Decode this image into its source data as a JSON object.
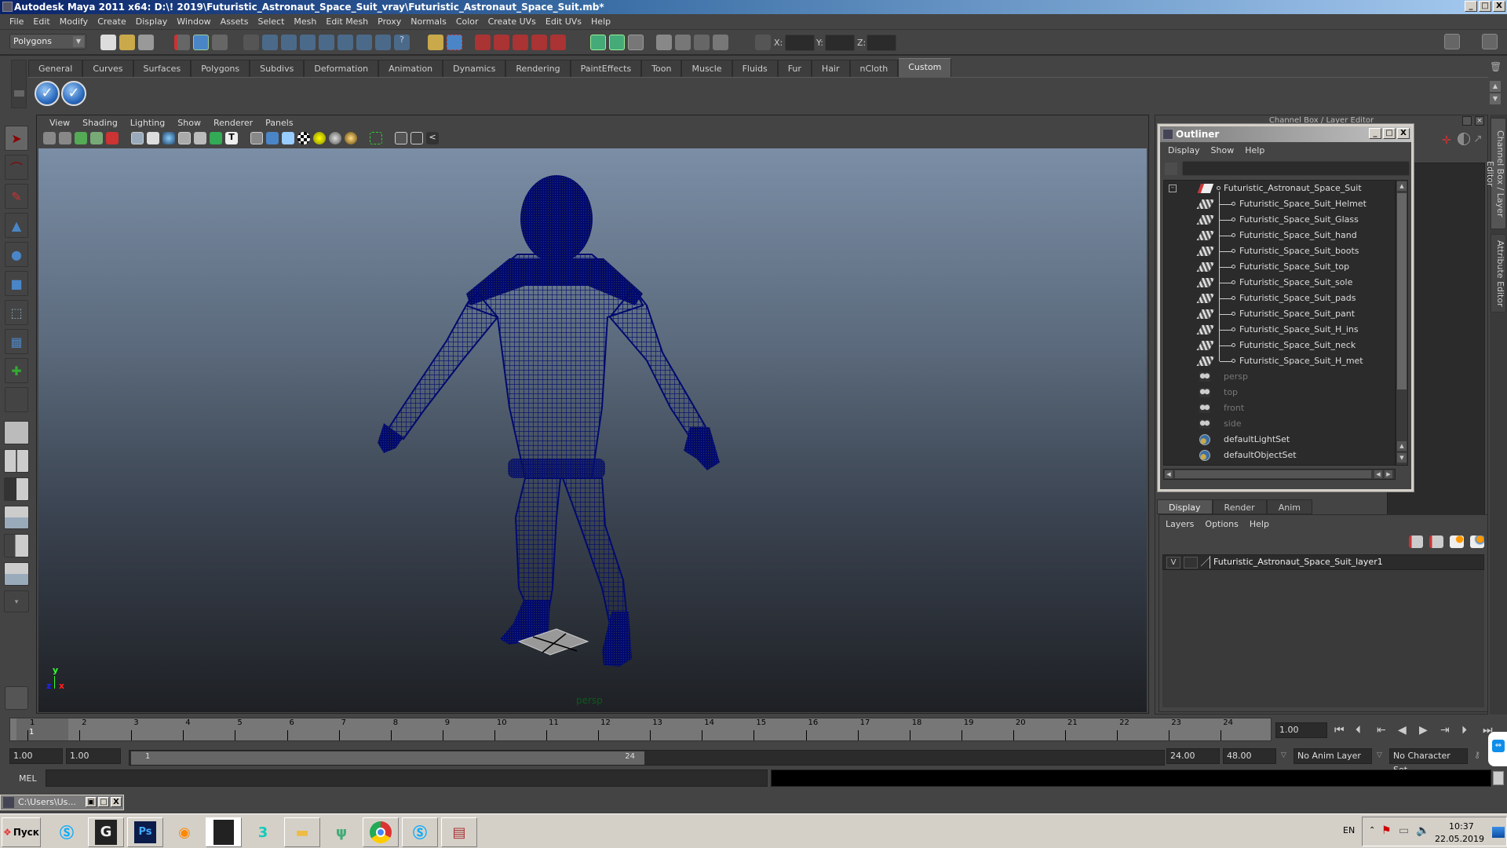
{
  "window": {
    "title": "Autodesk Maya 2011 x64: D:\\! 2019\\Futuristic_Astronaut_Space_Suit_vray\\Futuristic_Astronaut_Space_Suit.mb*",
    "buttons": {
      "minimize": "_",
      "maximize": "□",
      "close": "X"
    }
  },
  "menubar": [
    "File",
    "Edit",
    "Modify",
    "Create",
    "Display",
    "Window",
    "Assets",
    "Select",
    "Mesh",
    "Edit Mesh",
    "Proxy",
    "Normals",
    "Color",
    "Create UVs",
    "Edit UVs",
    "Help"
  ],
  "statusline": {
    "menuset": "Polygons",
    "coord_labels": [
      "X:",
      "Y:",
      "Z:"
    ],
    "coord_values": [
      "",
      "",
      ""
    ]
  },
  "shelf": {
    "tabs": [
      "General",
      "Curves",
      "Surfaces",
      "Polygons",
      "Subdivs",
      "Deformation",
      "Animation",
      "Dynamics",
      "Rendering",
      "PaintEffects",
      "Toon",
      "Muscle",
      "Fluids",
      "Fur",
      "Hair",
      "nCloth",
      "Custom"
    ],
    "active_tab": "Custom",
    "buttons": [
      "check-icon",
      "check-icon"
    ]
  },
  "toolbox": {
    "tools": [
      "select-tool",
      "lasso-tool",
      "paint-select-tool",
      "move-tool",
      "rotate-tool",
      "scale-tool",
      "universal-manipulator",
      "soft-mod-tool",
      "show-manipulator",
      "last-tool"
    ],
    "layouts": [
      "single-perspective-layout",
      "four-view-layout",
      "outliner-persp-layout",
      "persp-graph-layout",
      "hypershade-persp-layout",
      "persp-outliner-graph-layout"
    ]
  },
  "viewport": {
    "menu": [
      "View",
      "Shading",
      "Lighting",
      "Show",
      "Renderer",
      "Panels"
    ],
    "camera_label": "persp",
    "axis": {
      "x": "x",
      "y": "y",
      "z": "z"
    },
    "background": {
      "top": "#7b8ea6",
      "bottom": "#1e2024"
    },
    "wireframe_color": "#000a6e"
  },
  "channelbox": {
    "title": "Channel Box / Layer Editor",
    "side_tabs": [
      "Channel Box / Layer Editor",
      "Attribute Editor"
    ]
  },
  "outliner": {
    "title": "Outliner",
    "menu": [
      "Display",
      "Show",
      "Help"
    ],
    "filter_value": "",
    "root": "Futuristic_Astronaut_Space_Suit",
    "children": [
      "Futuristic_Space_Suit_Helmet",
      "Futuristic_Space_Suit_Glass",
      "Futuristic_Space_Suit_hand",
      "Futuristic_Space_Suit_boots",
      "Futuristic_Space_Suit_top",
      "Futuristic_Space_Suit_sole",
      "Futuristic_Space_Suit_pads",
      "Futuristic_Space_Suit_pant",
      "Futuristic_Space_Suit_H_ins",
      "Futuristic_Space_Suit_neck",
      "Futuristic_Space_Suit_H_met"
    ],
    "cameras": [
      "persp",
      "top",
      "front",
      "side"
    ],
    "sets": [
      "defaultLightSet",
      "defaultObjectSet"
    ]
  },
  "layers": {
    "tabs": [
      "Display",
      "Render",
      "Anim"
    ],
    "active_tab": "Display",
    "menu": [
      "Layers",
      "Options",
      "Help"
    ],
    "rows": [
      {
        "visible": "V",
        "name": "Futuristic_Astronaut_Space_Suit_layer1"
      }
    ]
  },
  "timeline": {
    "ticks": [
      "1",
      "2",
      "3",
      "4",
      "5",
      "6",
      "7",
      "8",
      "9",
      "10",
      "11",
      "12",
      "13",
      "14",
      "15",
      "16",
      "17",
      "18",
      "19",
      "20",
      "21",
      "22",
      "23",
      "24"
    ],
    "current_frame_marker": "1",
    "current_frame": "1.00"
  },
  "range": {
    "start_time": "1.00",
    "playback_start": "1.00",
    "slider_start": "1",
    "slider_end": "24",
    "playback_end": "24.00",
    "end_time": "48.00",
    "anim_layer": "No Anim Layer",
    "character_set": "No Character Set"
  },
  "commandline": {
    "label": "MEL",
    "input": "",
    "output": ""
  },
  "minimized_window": {
    "title": "C:\\Users\\Us..."
  },
  "taskbar": {
    "start_label": "Пуск",
    "apps": [
      "skype",
      "3ds-max-design",
      "photoshop",
      "blender",
      "maya",
      "3ds-max",
      "windows-explorer",
      "mudbox",
      "chrome",
      "skype-business",
      "winrar"
    ],
    "language": "EN",
    "time": "10:37",
    "date": "22.05.2019"
  }
}
